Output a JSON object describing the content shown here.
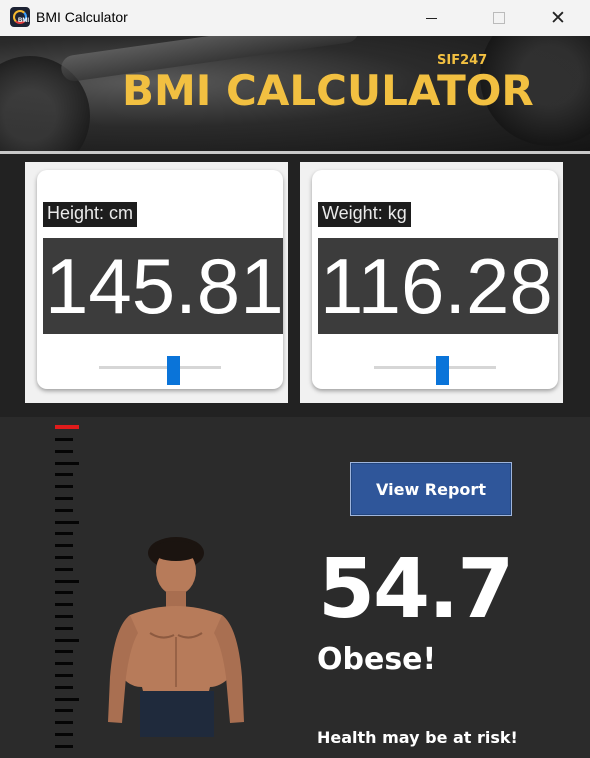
{
  "window": {
    "title": "BMI Calculator",
    "minimize_icon": "minimize-icon",
    "maximize_icon": "maximize-icon",
    "close_glyph": "✕"
  },
  "banner": {
    "title": "BMI CALCULATOR",
    "subtitle": "SIF247",
    "text_color": "#f2c041"
  },
  "height": {
    "label": "Height: cm",
    "value": "145.81",
    "slider_fraction": 0.62
  },
  "weight": {
    "label": "Weight: kg",
    "value": "116.28",
    "slider_fraction": 0.57
  },
  "results": {
    "button_label": "View Report",
    "bmi": "54.7",
    "status": "Obese!",
    "note": "Health may be at risk!",
    "gauge_marker_color": "#e01b1b",
    "accent": "#0a74d9",
    "button_color": "#2f569a"
  }
}
